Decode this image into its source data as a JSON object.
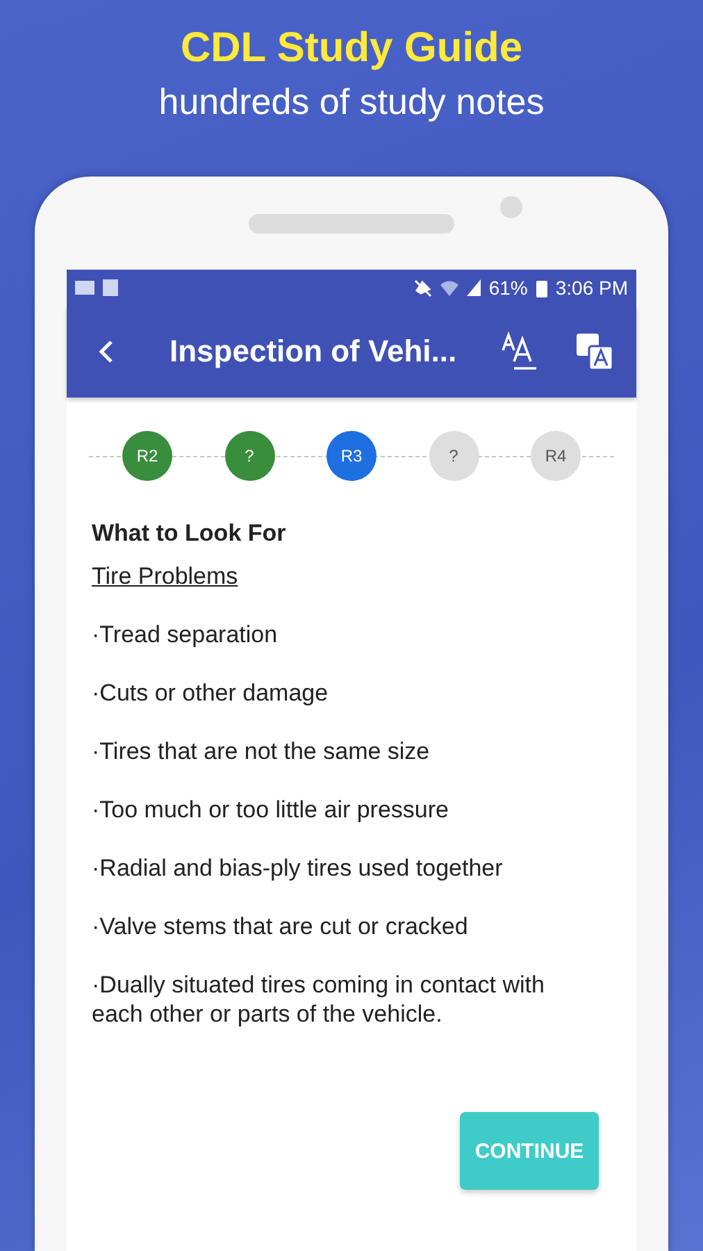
{
  "promo": {
    "title": "CDL Study Guide",
    "subtitle": "hundreds of study notes"
  },
  "status_bar": {
    "time": "3:06 PM",
    "battery": "61%"
  },
  "app_bar": {
    "title": "Inspection of Vehi..."
  },
  "steps": [
    {
      "label": "R2",
      "kind": "done"
    },
    {
      "label": "?",
      "kind": "done"
    },
    {
      "label": "R3",
      "kind": "current"
    },
    {
      "label": "?",
      "kind": "pending"
    },
    {
      "label": "R4",
      "kind": "pending"
    }
  ],
  "heading": "What to Look For",
  "subheading": "Tire Problems",
  "items": [
    "·Tread separation",
    "·Cuts or other damage",
    "·Tires that are not the same size",
    "·Too much or too little air pressure",
    "·Radial and bias-ply tires used together",
    "·Valve stems that are cut or cracked",
    "·Dually situated tires coming in contact with each other or parts of the vehicle."
  ],
  "button": "CONTINUE"
}
